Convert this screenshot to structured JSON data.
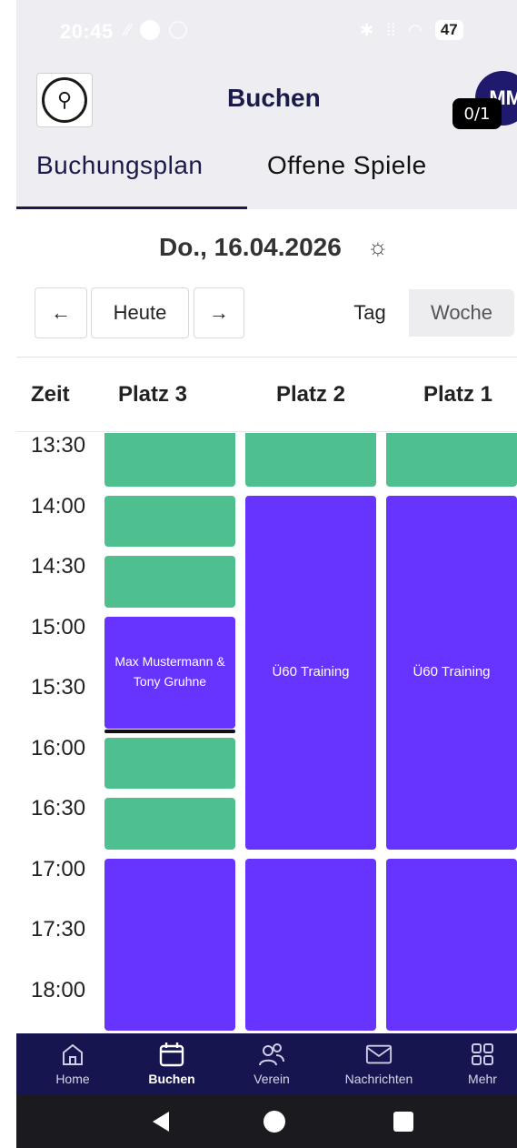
{
  "status_bar": {
    "time": "20:45",
    "battery": "47"
  },
  "app_bar": {
    "title": "Buchen",
    "avatar_initials": "MM",
    "counter": "0/1"
  },
  "tabs": [
    {
      "label": "Buchungsplan",
      "active": true
    },
    {
      "label": "Offene Spiele",
      "active": false
    }
  ],
  "date": {
    "text": "Do., 16.04.2026",
    "weather_icon": "cloud-sun-icon"
  },
  "controls": {
    "prev": "←",
    "today": "Heute",
    "next": "→",
    "view_day": "Tag",
    "view_week": "Woche",
    "selected_view": "Tag"
  },
  "columns": {
    "time": "Zeit",
    "courts": [
      "Platz 3",
      "Platz 2",
      "Platz 1"
    ]
  },
  "times": [
    "13:30",
    "14:00",
    "14:30",
    "15:00",
    "15:30",
    "16:00",
    "16:30",
    "17:00",
    "17:30",
    "18:00"
  ],
  "slots": {
    "platz3": [
      {
        "start": "13:30",
        "end": "14:00",
        "status": "free"
      },
      {
        "start": "14:00",
        "end": "14:30",
        "status": "free"
      },
      {
        "start": "14:30",
        "end": "15:00",
        "status": "free"
      },
      {
        "start": "15:00",
        "end": "16:00",
        "status": "booked",
        "label": "Max Mustermann & Tony Gruhne"
      },
      {
        "start": "16:00",
        "end": "16:30",
        "status": "free"
      },
      {
        "start": "16:30",
        "end": "17:00",
        "status": "free"
      },
      {
        "start": "17:00",
        "end": "18:30",
        "status": "booked"
      }
    ],
    "platz2": [
      {
        "start": "13:30",
        "end": "14:00",
        "status": "free"
      },
      {
        "start": "14:00",
        "end": "17:00",
        "status": "booked",
        "label": "Ü60 Training"
      },
      {
        "start": "17:00",
        "end": "18:30",
        "status": "booked"
      }
    ],
    "platz1": [
      {
        "start": "13:30",
        "end": "14:00",
        "status": "free"
      },
      {
        "start": "14:00",
        "end": "17:00",
        "status": "booked",
        "label": "Ü60 Training"
      },
      {
        "start": "17:00",
        "end": "18:30",
        "status": "booked"
      }
    ]
  },
  "colors": {
    "free": "#4ec08f",
    "booked": "#6633ff",
    "primary": "#1a1b4b",
    "nav_bg": "#17154f"
  },
  "bottom_nav": [
    {
      "label": "Home",
      "icon": "home-icon",
      "active": false
    },
    {
      "label": "Buchen",
      "icon": "calendar-icon",
      "active": true
    },
    {
      "label": "Verein",
      "icon": "users-icon",
      "active": false
    },
    {
      "label": "Nachrichten",
      "icon": "mail-icon",
      "active": false
    },
    {
      "label": "Mehr",
      "icon": "grid-icon",
      "active": false
    }
  ]
}
